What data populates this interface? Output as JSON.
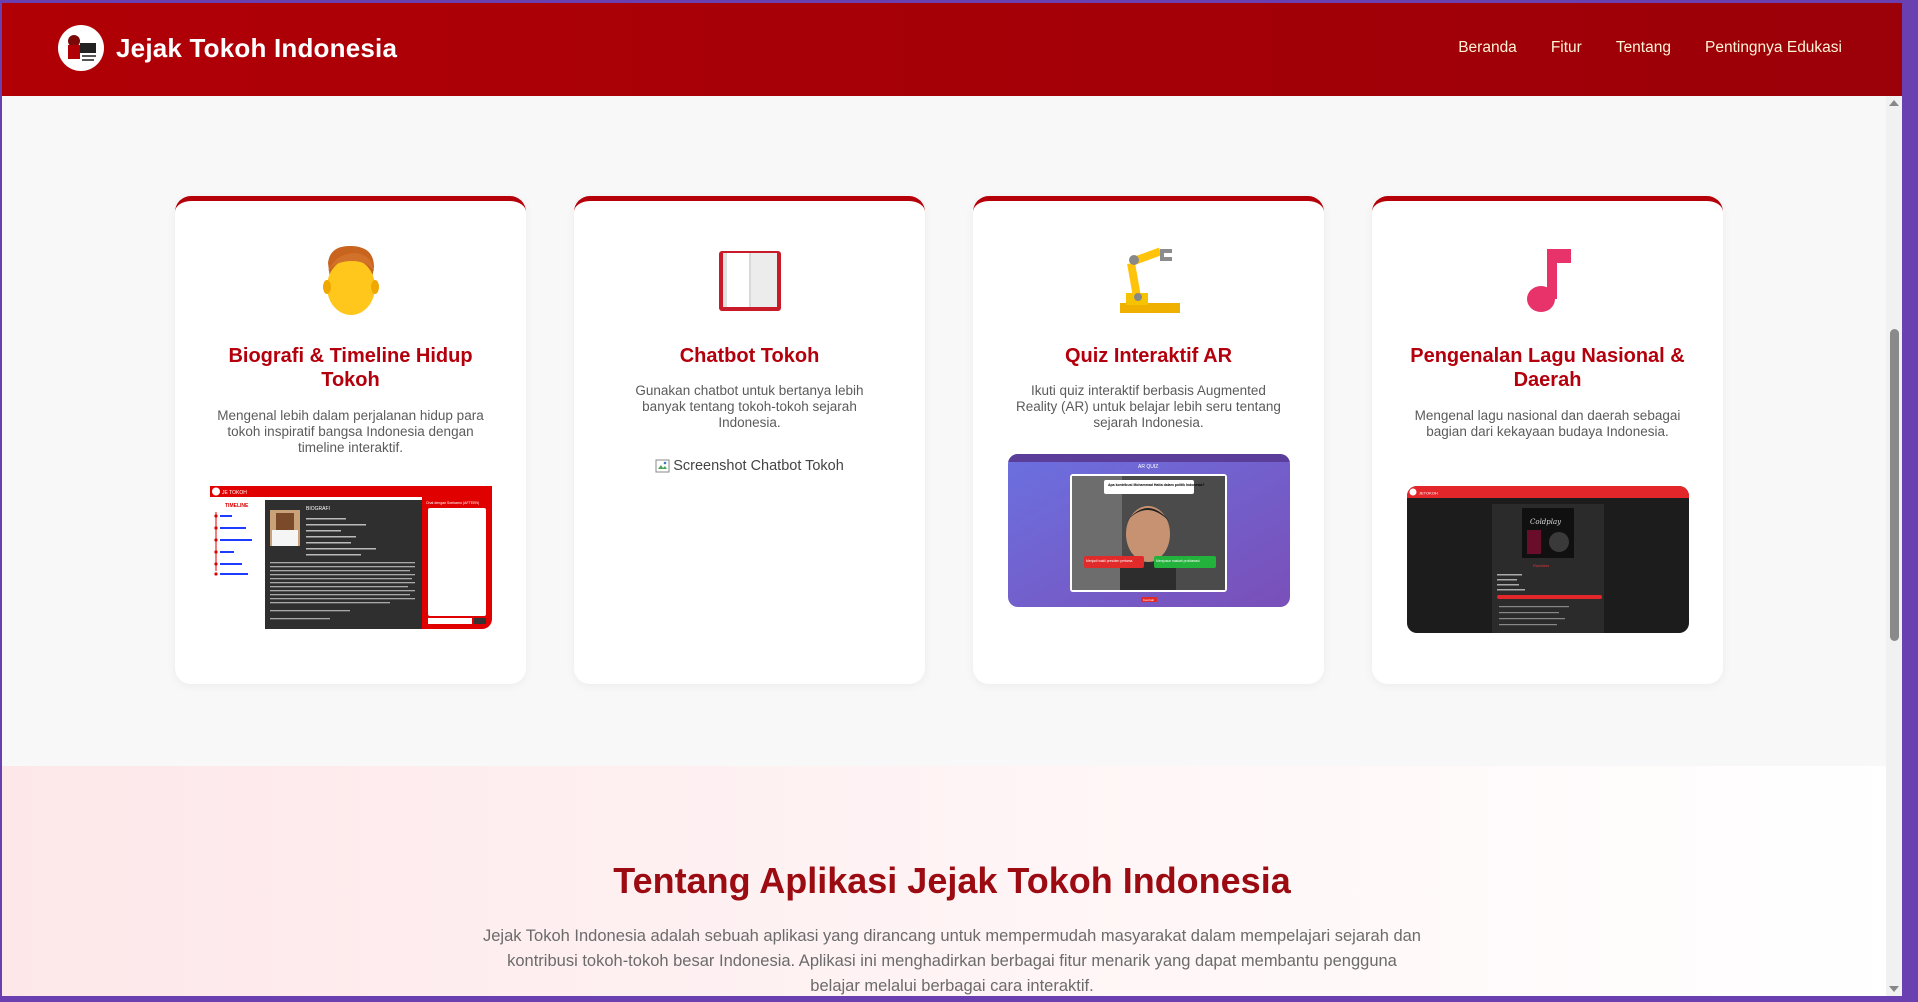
{
  "header": {
    "title": "Jejak Tokoh Indonesia",
    "logo_text": "Jejak Tokoh Indonesia",
    "nav": [
      "Beranda",
      "Fitur",
      "Tentang",
      "Pentingnya Edukasi"
    ]
  },
  "features": [
    {
      "icon": "person-face-icon",
      "title": "Biografi & Timeline Hidup Tokoh",
      "desc": "Mengenal lebih dalam perjalanan hidup para tokoh inspiratif bangsa Indonesia dengan timeline interaktif.",
      "shot": {
        "app_label": "JE TOKOH",
        "timeline_label": "TIMELINE",
        "section_label": "BIOGRAFI",
        "chat_label": "Chat dengan Soekarno (AFTEEN)"
      }
    },
    {
      "icon": "open-book-icon",
      "title": "Chatbot Tokoh",
      "desc": "Gunakan chatbot untuk bertanya lebih banyak tentang tokoh-tokoh sejarah Indonesia.",
      "image_alt": "Screenshot Chatbot Tokoh"
    },
    {
      "icon": "robot-arm-icon",
      "title": "Quiz Interaktif AR",
      "desc": "Ikuti quiz interaktif berbasis Augmented Reality (AR) untuk belajar lebih seru tentang sejarah Indonesia.",
      "shot": {
        "header": "AR QUIZ",
        "question": "Apa kontribusi Mohammad Hatta dalam politik Indonesia?",
        "answer_left": "Menjadi wakil presiden pertama",
        "answer_right": "Menyusun naskah proklamasi",
        "button": "Kembali"
      }
    },
    {
      "icon": "music-note-icon",
      "title": "Pengenalan Lagu Nasional & Daerah",
      "desc": "Mengenal lagu nasional dan daerah sebagai bagian dari kekayaan budaya Indonesia.",
      "shot": {
        "app_label": "JETOKOH",
        "album_text": "Coldplay",
        "song_title": "Rumbers"
      }
    }
  ],
  "about": {
    "title": "Tentang Aplikasi Jejak Tokoh Indonesia",
    "text": "Jejak Tokoh Indonesia adalah sebuah aplikasi yang dirancang untuk mempermudah masyarakat dalam mempelajari sejarah dan kontribusi tokoh-tokoh besar Indonesia. Aplikasi ini menghadirkan berbagai fitur menarik yang dapat membantu pengguna belajar melalui berbagai cara interaktif."
  },
  "colors": {
    "primary": "#b00006",
    "heading": "#b3000c",
    "nav_text": "#fff3d6",
    "about_title": "#9b0b11"
  }
}
